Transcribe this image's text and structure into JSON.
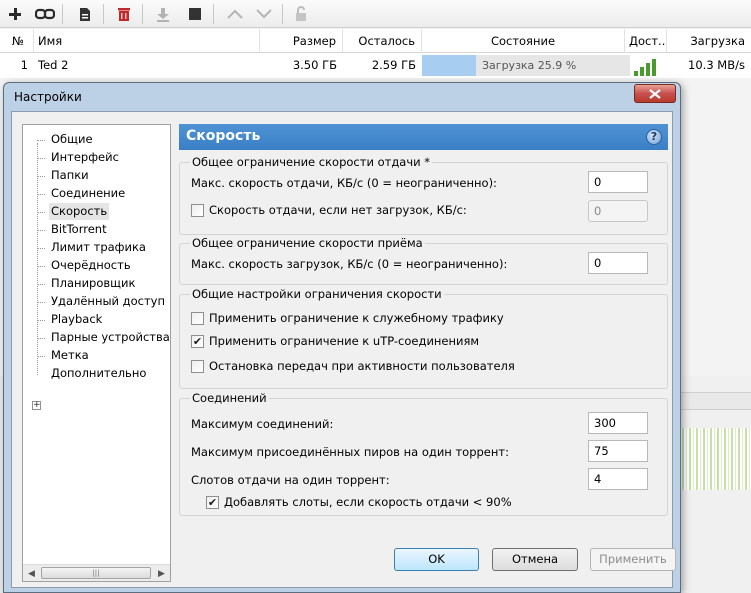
{
  "toolbar": {
    "icons": [
      "add-icon",
      "link-icon",
      "file-icon",
      "delete-icon",
      "download-icon",
      "stop-icon",
      "up-icon",
      "down-icon",
      "lock-icon"
    ],
    "delete_color": "#c0282c"
  },
  "torrent_list": {
    "columns": [
      "№",
      "Имя",
      "Размер",
      "Осталось",
      "Состояние",
      "Дост...",
      "Загрузка"
    ],
    "rows": [
      {
        "num": "1",
        "name": "Ted 2",
        "size": "3.50 ГБ",
        "remaining": "2.59 ГБ",
        "status": "Загрузка 25.9 %",
        "progress": 0.259,
        "speed": "10.3 MB/s"
      }
    ]
  },
  "dialog": {
    "title": "Настройки",
    "tree": {
      "items": [
        "Общие",
        "Интерфейс",
        "Папки",
        "Соединение",
        "Скорость",
        "BitTorrent",
        "Лимит трафика",
        "Очерёдность",
        "Планировщик",
        "Удалённый доступ",
        "Playback",
        "Парные устройства",
        "Метка",
        "Дополнительно"
      ],
      "selected": "Скорость",
      "expander": "+",
      "scroll_grip": "|||"
    },
    "section_title": "Скорость",
    "help_symbol": "?",
    "upload_group": {
      "title": "Общее ограничение скорости отдачи *",
      "max_label": "Макс. скорость отдачи, КБ/с (0 = неограниченно):",
      "max_value": "0",
      "idle_label": "Скорость отдачи, если нет загрузок, КБ/с:",
      "idle_checked": false,
      "idle_value": "0"
    },
    "download_group": {
      "title": "Общее ограничение скорости приёма",
      "max_label": "Макс. скорость загрузок, КБ/с (0 = неограниченно):",
      "max_value": "0"
    },
    "general_group": {
      "title": "Общие настройки ограничения скорости",
      "opt1": "Применить ограничение к служебному трафику",
      "opt1_checked": false,
      "opt2": "Применить ограничение к uTP-соединениям",
      "opt2_checked": true,
      "opt3": "Остановка передач при активности пользователя",
      "opt3_checked": false
    },
    "connections_group": {
      "title": "Соединений",
      "max_conn_label": "Максимум соединений:",
      "max_conn_value": "300",
      "max_peers_label": "Максимум присоединённых пиров на один торрент:",
      "max_peers_value": "75",
      "slots_label": "Слотов отдачи на один торрент:",
      "slots_value": "4",
      "add_slots_label": "Добавлять слоты, если скорость отдачи < 90%",
      "add_slots_checked": true
    },
    "buttons": {
      "ok": "OK",
      "cancel": "Отмена",
      "apply": "Применить"
    },
    "check_mark": "✔"
  }
}
